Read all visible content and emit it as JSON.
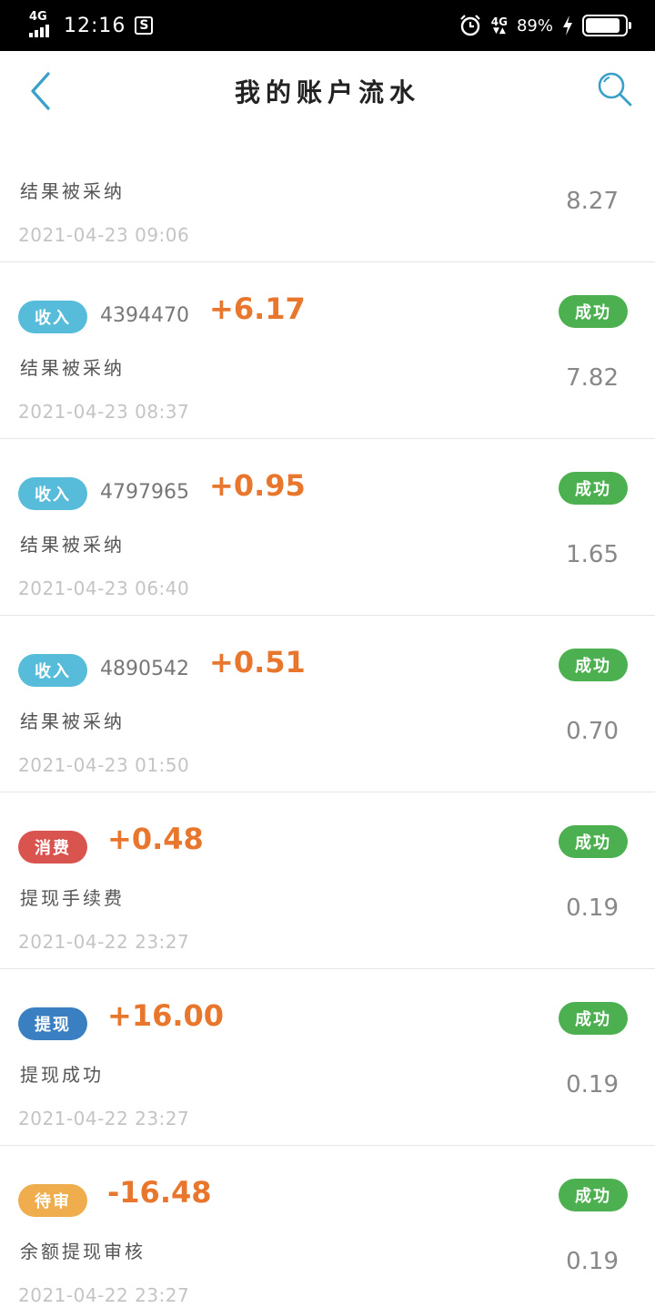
{
  "status_bar": {
    "network": "4G",
    "time": "12:16",
    "s_icon": "S",
    "network_right": "4G",
    "battery": "89%"
  },
  "header": {
    "title": "我的账户流水"
  },
  "colors": {
    "income": "#56bcd9",
    "consume": "#d9534f",
    "withdraw": "#3a7fc1",
    "review": "#f0ad4e",
    "success": "#4caf50",
    "amount": "#e8762c",
    "accent": "#3aa0c8"
  },
  "records": [
    {
      "tag": "",
      "tag_color": "#56bcd9",
      "id": "",
      "amount": "",
      "status": "",
      "desc": "结果被采纳",
      "balance": "8.27",
      "time": "2021-04-23 09:06"
    },
    {
      "tag": "收入",
      "tag_color": "#56bcd9",
      "id": "4394470",
      "amount": "+6.17",
      "status": "成功",
      "desc": "结果被采纳",
      "balance": "7.82",
      "time": "2021-04-23 08:37"
    },
    {
      "tag": "收入",
      "tag_color": "#56bcd9",
      "id": "4797965",
      "amount": "+0.95",
      "status": "成功",
      "desc": "结果被采纳",
      "balance": "1.65",
      "time": "2021-04-23 06:40"
    },
    {
      "tag": "收入",
      "tag_color": "#56bcd9",
      "id": "4890542",
      "amount": "+0.51",
      "status": "成功",
      "desc": "结果被采纳",
      "balance": "0.70",
      "time": "2021-04-23 01:50"
    },
    {
      "tag": "消费",
      "tag_color": "#d9534f",
      "id": "",
      "amount": "+0.48",
      "status": "成功",
      "desc": "提现手续费",
      "balance": "0.19",
      "time": "2021-04-22 23:27"
    },
    {
      "tag": "提现",
      "tag_color": "#3a7fc1",
      "id": "",
      "amount": "+16.00",
      "status": "成功",
      "desc": "提现成功",
      "balance": "0.19",
      "time": "2021-04-22 23:27"
    },
    {
      "tag": "待审",
      "tag_color": "#f0ad4e",
      "id": "",
      "amount": "-16.48",
      "status": "成功",
      "desc": "余额提现审核",
      "balance": "0.19",
      "time": "2021-04-22 23:27"
    }
  ]
}
